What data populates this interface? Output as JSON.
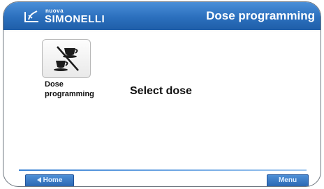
{
  "header": {
    "brand_small": "nuova",
    "brand_main": "SIMONELLI",
    "title": "Dose programming",
    "logo_icon": "simonelli-logo-icon"
  },
  "main": {
    "tile_label": "Dose\nprogramming",
    "tile_icon": "cup-crossed-icon",
    "prompt": "Select dose"
  },
  "footer": {
    "home_label": "Home",
    "menu_label": "Menu"
  },
  "colors": {
    "header_blue": "#2b6fbd",
    "button_blue": "#3a7bc8"
  }
}
